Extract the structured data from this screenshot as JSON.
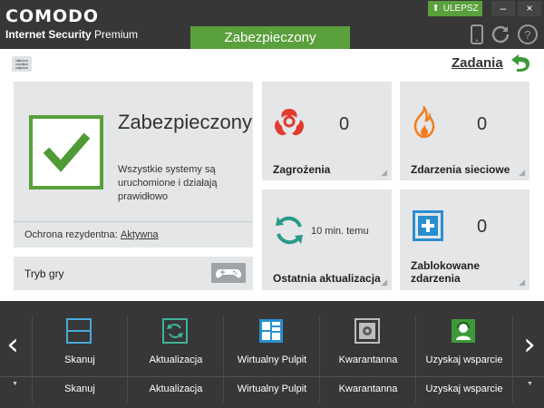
{
  "header": {
    "brand": "COMODO",
    "product_bold": "Internet Security",
    "product_light": "Premium",
    "status_tab": "Zabezpieczony",
    "upgrade_label": "ULEPSZ",
    "minimize": "–",
    "close": "×"
  },
  "toolbar": {
    "tasks_label": "Zadania"
  },
  "status_card": {
    "title": "Zabezpieczony",
    "description": "Wszystkie systemy są uruchomione i działają prawidłowo",
    "resident_label": "Ochrona rezydentna:",
    "resident_value": "Aktywna",
    "game_mode_label": "Tryb gry"
  },
  "stats": {
    "threats": {
      "label": "Zagrożenia",
      "count": "0"
    },
    "network_events": {
      "label": "Zdarzenia sieciowe",
      "count": "0"
    },
    "last_update": {
      "label": "Ostatnia aktualizacja",
      "value": "10 min. temu"
    },
    "blocked_events": {
      "label": "Zablokowane zdarzenia",
      "count": "0"
    }
  },
  "dock": {
    "items": [
      {
        "label": "Skanuj",
        "icon": "scan-icon"
      },
      {
        "label": "Aktualizacja",
        "icon": "update-icon"
      },
      {
        "label": "Wirtualny Pulpit",
        "icon": "virtual-desktop-icon"
      },
      {
        "label": "Kwarantanna",
        "icon": "quarantine-icon"
      },
      {
        "label": "Uzyskaj wsparcie",
        "icon": "support-icon"
      }
    ],
    "left_arrow": "‹",
    "right_arrow": "›"
  },
  "colors": {
    "accent_green": "#5aa03c",
    "threat_red": "#e23a2e",
    "network_orange": "#f07d1e",
    "update_teal": "#2a9a8a",
    "blocked_blue": "#2a8fcf",
    "header_dark": "#373737"
  }
}
